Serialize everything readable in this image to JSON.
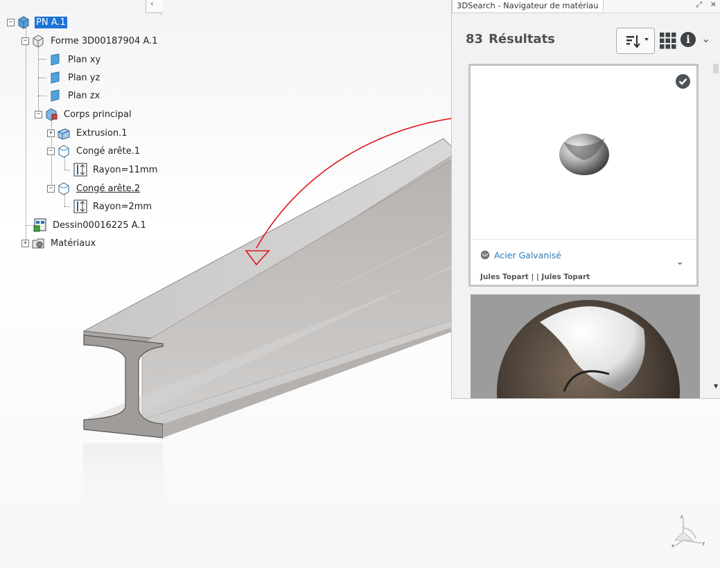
{
  "tree": {
    "collapse_chevron": "‹",
    "nodes": [
      {
        "label": "PN A.1",
        "pm": "−",
        "icon": "product-icon"
      },
      {
        "label": "Forme 3D00187904 A.1",
        "pm": "−",
        "icon": "shape-icon"
      },
      {
        "label": "Plan xy",
        "icon": "plane-icon"
      },
      {
        "label": "Plan yz",
        "icon": "plane-icon"
      },
      {
        "label": "Plan zx",
        "icon": "plane-icon"
      },
      {
        "label": "Corps principal",
        "pm": "−",
        "icon": "body-icon"
      },
      {
        "label": "Extrusion.1",
        "pm": "+",
        "icon": "extrusion-icon"
      },
      {
        "label": "Congé arête.1",
        "pm": "−",
        "icon": "fillet-icon"
      },
      {
        "label": "Rayon=11mm",
        "icon": "radius-icon"
      },
      {
        "label": "Congé arête.2",
        "pm": "−",
        "icon": "fillet-icon"
      },
      {
        "label": "Rayon=2mm",
        "icon": "radius-icon"
      },
      {
        "label": "Dessin00016225 A.1",
        "icon": "drawing-icon"
      },
      {
        "label": "Matériaux",
        "pm": "+",
        "icon": "materials-icon"
      }
    ]
  },
  "panel": {
    "title": "3DSearch - Navigateur de matériau",
    "controls": "⤢ ✕",
    "results_count": "83",
    "results_label": "Résultats",
    "info_glyph": "i",
    "expand_glyph": "⌄",
    "card1": {
      "material_name": "Acier Galvanisé",
      "author": "Jules Topart |  | Jules Topart",
      "expand_glyph": "⌄",
      "selected": true
    }
  },
  "compass": {
    "z": "z",
    "x": "x",
    "y": "y"
  },
  "colors": {
    "selection": "#1a73d9",
    "link": "#2d78b8",
    "annotation": "#e0141c"
  }
}
